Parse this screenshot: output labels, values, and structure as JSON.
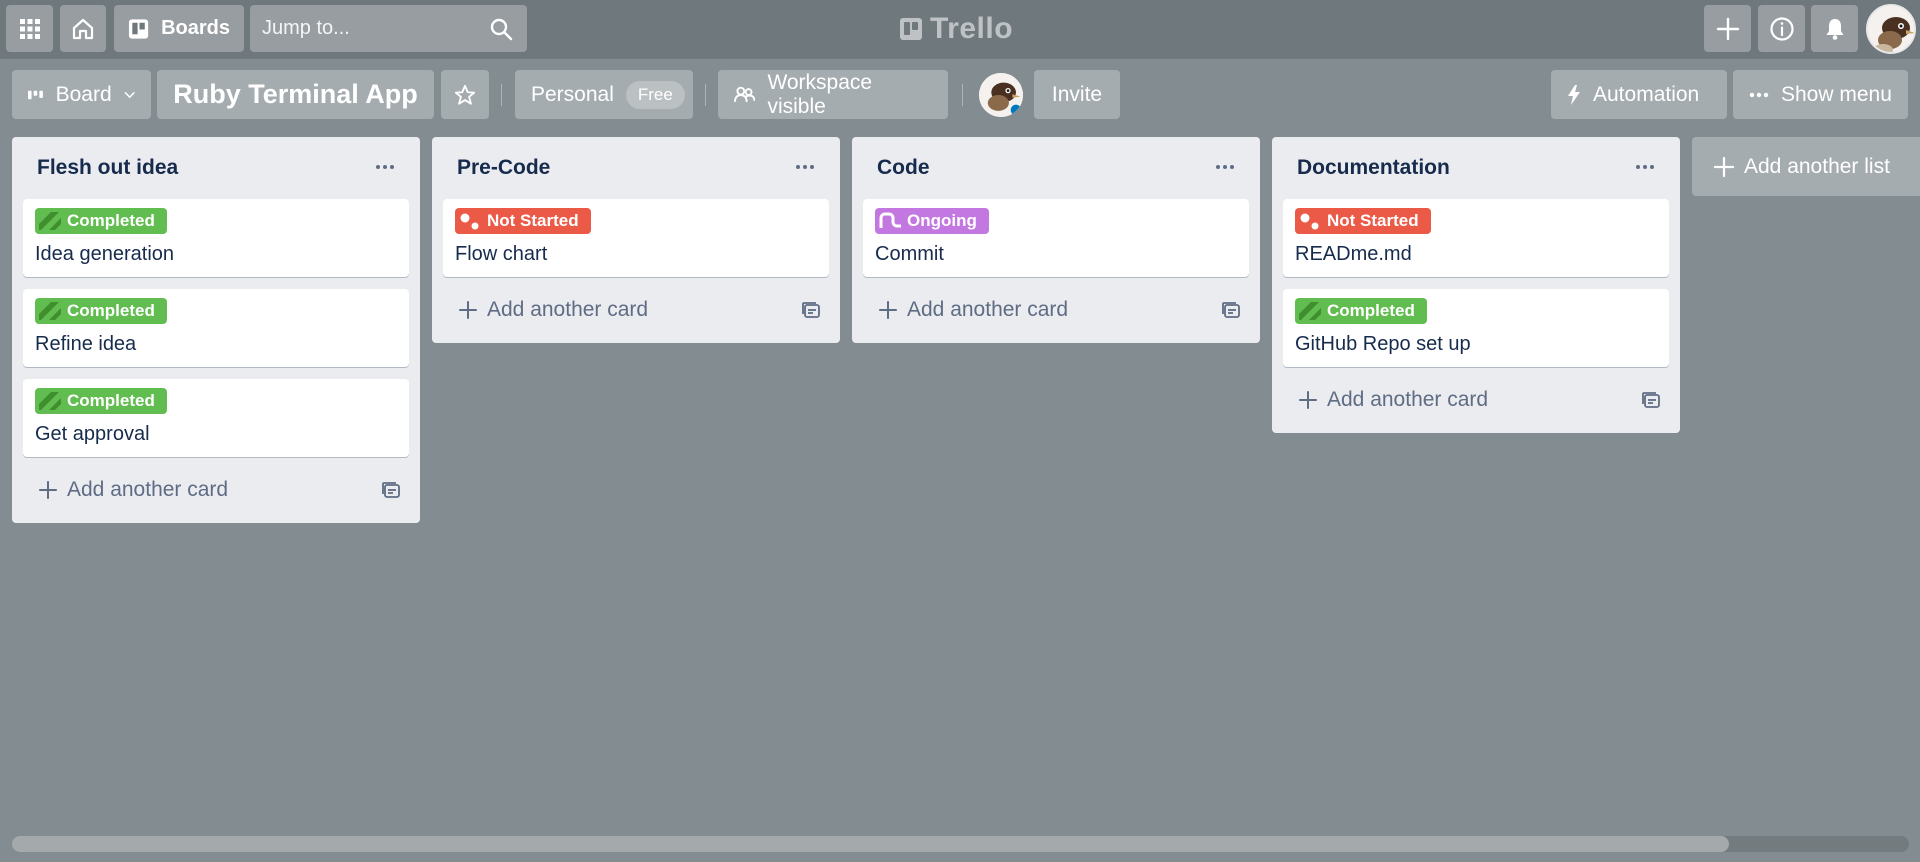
{
  "topbar": {
    "boards_label": "Boards",
    "search_placeholder": "Jump to...",
    "logo_text": "Trello"
  },
  "board_header": {
    "view_label": "Board",
    "title": "Ruby Terminal App",
    "workspace_label": "Personal",
    "plan_badge": "Free",
    "visibility_label": "Workspace visible",
    "invite_label": "Invite",
    "automation_label": "Automation",
    "show_menu_label": "Show menu"
  },
  "labels": {
    "completed": {
      "text": "Completed",
      "color": "#61bd4f"
    },
    "not_started": {
      "text": "Not Started",
      "color": "#eb5a46"
    },
    "ongoing": {
      "text": "Ongoing",
      "color": "#c377e0"
    }
  },
  "lists": [
    {
      "title": "Flesh out idea",
      "cards": [
        {
          "label": "Completed",
          "title": "Idea generation"
        },
        {
          "label": "Completed",
          "title": "Refine idea"
        },
        {
          "label": "Completed",
          "title": "Get approval"
        }
      ],
      "add_card_label": "Add another card"
    },
    {
      "title": "Pre-Code",
      "cards": [
        {
          "label": "Not Started",
          "title": "Flow chart"
        }
      ],
      "add_card_label": "Add another card"
    },
    {
      "title": "Code",
      "cards": [
        {
          "label": "Ongoing",
          "title": "Commit"
        }
      ],
      "add_card_label": "Add another card"
    },
    {
      "title": "Documentation",
      "cards": [
        {
          "label": "Not Started",
          "title": "READme.md"
        },
        {
          "label": "Completed",
          "title": "GitHub Repo set up"
        }
      ],
      "add_card_label": "Add another card"
    }
  ],
  "add_list_label": "Add another list",
  "horizontal_scroll": {
    "visible_fraction": 0.905
  }
}
